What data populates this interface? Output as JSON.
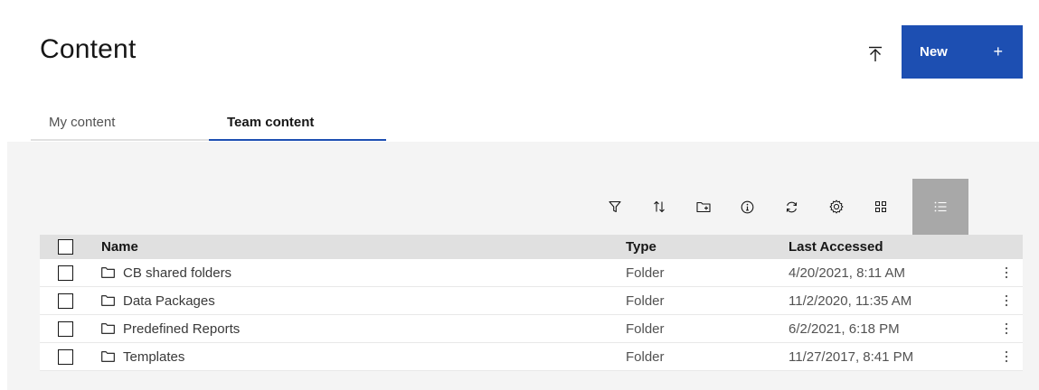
{
  "header": {
    "title": "Content",
    "new_label": "New",
    "new_plus": "+"
  },
  "tabs": [
    {
      "label": "My content",
      "active": false
    },
    {
      "label": "Team content",
      "active": true
    }
  ],
  "toolbar": {
    "icons": [
      "filter-icon",
      "sort-icon",
      "new-folder-icon",
      "info-icon",
      "refresh-icon",
      "settings-icon",
      "grid-view-icon",
      "list-view-icon"
    ]
  },
  "table": {
    "columns": {
      "name": "Name",
      "type": "Type",
      "last_accessed": "Last Accessed"
    },
    "rows": [
      {
        "name": "CB shared folders",
        "type": "Folder",
        "last_accessed": "4/20/2021, 8:11 AM"
      },
      {
        "name": "Data Packages",
        "type": "Folder",
        "last_accessed": "11/2/2020, 11:35 AM"
      },
      {
        "name": "Predefined Reports",
        "type": "Folder",
        "last_accessed": "6/2/2021, 6:18 PM"
      },
      {
        "name": "Templates",
        "type": "Folder",
        "last_accessed": "11/27/2017, 8:41 PM"
      }
    ]
  },
  "colors": {
    "accent": "#1d4fb2",
    "panel": "#f4f4f4",
    "header_row": "#e0e0e0",
    "active_view": "#a8a8a8"
  }
}
